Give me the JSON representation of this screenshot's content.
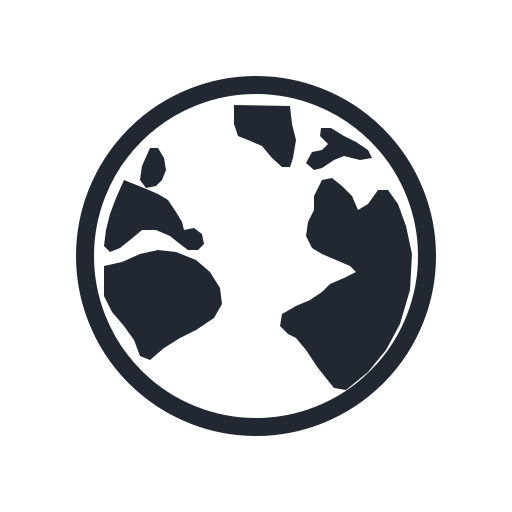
{
  "icon": {
    "name": "globe-icon",
    "color": "#222831",
    "background": "#ffffff"
  }
}
